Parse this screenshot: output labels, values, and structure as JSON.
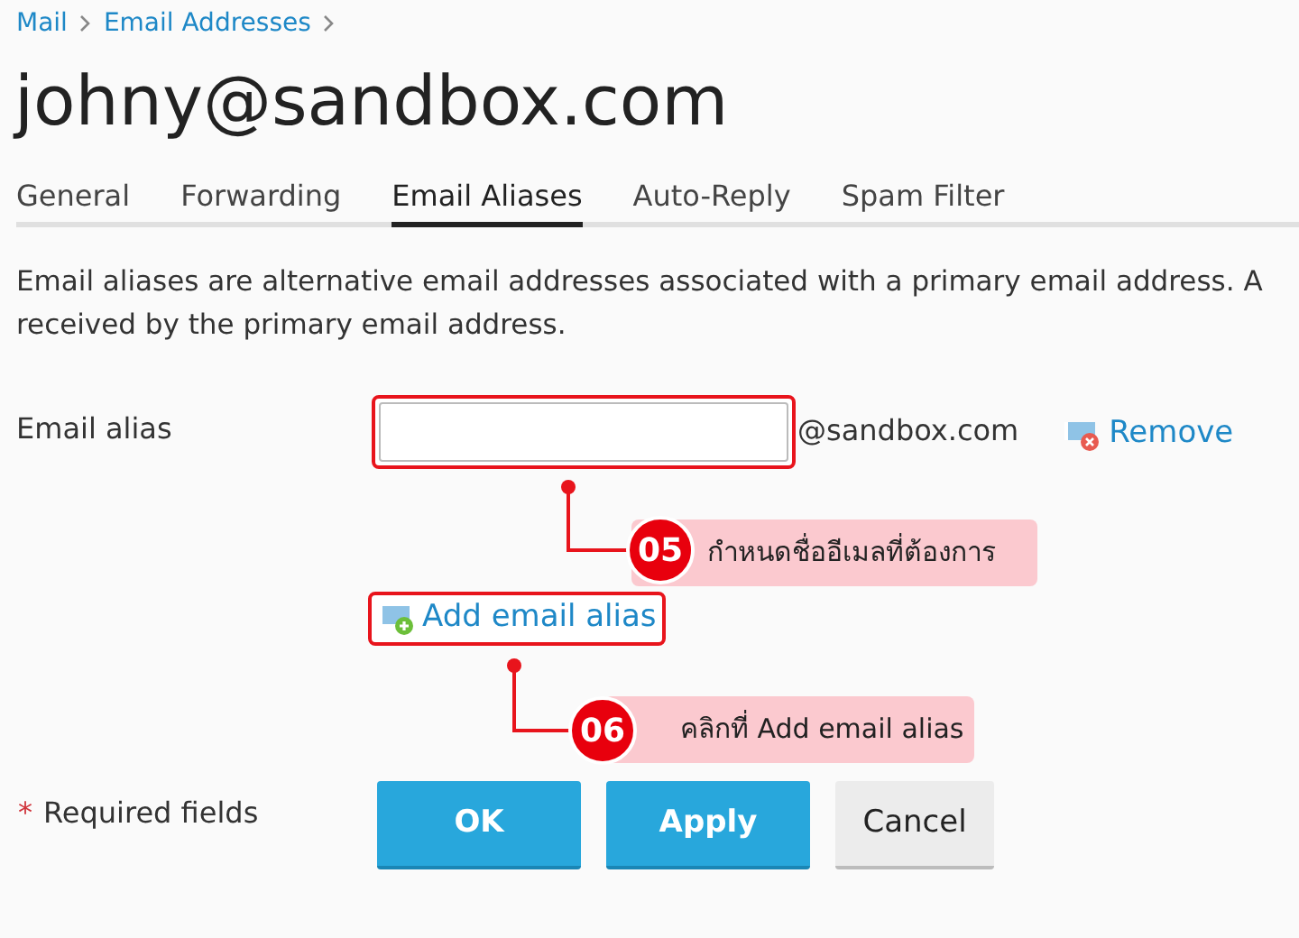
{
  "breadcrumb": [
    {
      "label": "Mail"
    },
    {
      "label": "Email Addresses"
    }
  ],
  "title": "johny@sandbox.com",
  "tabs": [
    {
      "label": "General",
      "selected": false
    },
    {
      "label": "Forwarding",
      "selected": false
    },
    {
      "label": "Email Aliases",
      "selected": true
    },
    {
      "label": "Auto-Reply",
      "selected": false
    },
    {
      "label": "Spam Filter",
      "selected": false
    }
  ],
  "description": [
    "Email aliases are alternative email addresses associated with a primary email address. A",
    "received by the primary email address."
  ],
  "alias_field": {
    "label": "Email alias",
    "suffix": "@sandbox.com",
    "remove": "Remove"
  },
  "add_link": "Add email alias",
  "required_note": {
    "mark": "*",
    "text": "Required fields"
  },
  "buttons": [
    {
      "label": "OK",
      "kind": "primary"
    },
    {
      "label": "Apply",
      "kind": "primary"
    },
    {
      "label": "Cancel",
      "kind": "secondary"
    }
  ],
  "annotations": [
    {
      "number": "05",
      "text": "กำหนดชื่ออีเมลที่ต้องการ"
    },
    {
      "number": "06",
      "text": "คลิกที่ Add email alias"
    }
  ]
}
